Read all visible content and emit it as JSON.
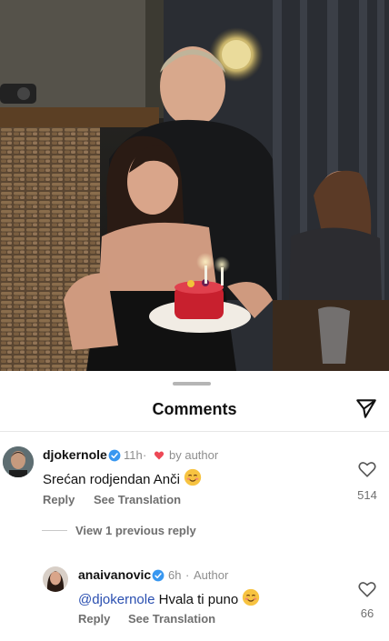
{
  "sheet": {
    "title": "Comments",
    "icons": {
      "share": "send-icon",
      "like": "heart-outline-icon",
      "verified": "verified-badge-icon"
    }
  },
  "comments": [
    {
      "username": "djokernole",
      "time": "11h",
      "liked_by_author": "by author",
      "text": "Srećan rodjendan Anči",
      "emoji": "smiling-face-emoji",
      "reply_label": "Reply",
      "translate_label": "See Translation",
      "likes": "514"
    }
  ],
  "view_previous": "View 1 previous reply",
  "replies": [
    {
      "username": "anaivanovic",
      "time": "6h",
      "separator": "·",
      "role": "Author",
      "mention": "@djokernole",
      "text": "Hvala ti puno",
      "emoji": "smiling-face-emoji",
      "reply_label": "Reply",
      "translate_label": "See Translation",
      "likes": "66"
    }
  ],
  "colors": {
    "mention": "#2a4fb0",
    "verified": "#3897f0",
    "like_heart": "#ed4956",
    "muted": "#8e8e8e"
  }
}
